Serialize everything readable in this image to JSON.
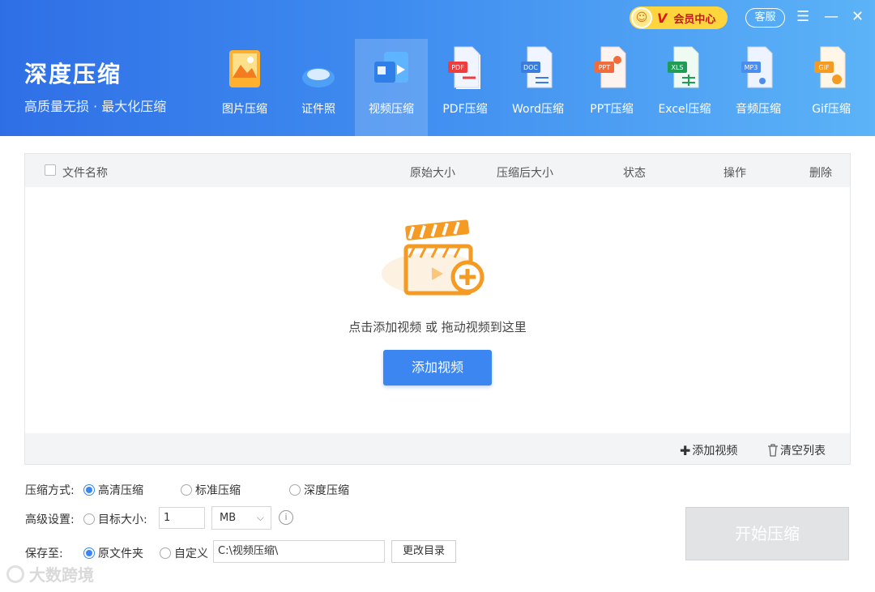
{
  "brand": {
    "title": "深度压缩",
    "subtitle": "高质量无损 · 最大化压缩"
  },
  "topbar": {
    "vip_label": "会员中心",
    "vip_letter": "V",
    "service_label": "客服",
    "menu_icon": "menu-icon",
    "minimize_icon": "minimize-icon",
    "close_icon": "close-icon"
  },
  "tabs": [
    {
      "label": "图片压缩",
      "icon": "image-file-icon"
    },
    {
      "label": "证件照",
      "icon": "id-photo-icon"
    },
    {
      "label": "视频压缩",
      "icon": "video-file-icon",
      "active": true
    },
    {
      "label": "PDF压缩",
      "icon": "pdf-file-icon",
      "badge": "PDF"
    },
    {
      "label": "Word压缩",
      "icon": "word-file-icon",
      "badge": "DOC"
    },
    {
      "label": "PPT压缩",
      "icon": "ppt-file-icon",
      "badge": "PPT"
    },
    {
      "label": "Excel压缩",
      "icon": "excel-file-icon",
      "badge": "XLS"
    },
    {
      "label": "音频压缩",
      "icon": "audio-file-icon",
      "badge": "MP3"
    },
    {
      "label": "Gif压缩",
      "icon": "gif-file-icon",
      "badge": "GIF"
    }
  ],
  "table": {
    "columns": [
      "文件名称",
      "原始大小",
      "压缩后大小",
      "状态",
      "操作",
      "删除"
    ]
  },
  "empty": {
    "hint": "点击添加视频 或 拖动视频到这里",
    "add_button": "添加视频"
  },
  "panel_footer": {
    "add_label": "添加视频",
    "clear_label": "清空列表"
  },
  "settings": {
    "mode_label": "压缩方式:",
    "modes": [
      {
        "label": "高清压缩",
        "selected": true
      },
      {
        "label": "标准压缩",
        "selected": false
      },
      {
        "label": "深度压缩",
        "selected": false
      }
    ],
    "advanced_label": "高级设置:",
    "target_size_label": "目标大小:",
    "target_size_value": "1",
    "unit_value": "MB",
    "save_label": "保存至:",
    "save_options": [
      {
        "label": "原文件夹",
        "selected": true
      },
      {
        "label": "自定义",
        "selected": false
      }
    ],
    "path_value": "C:\\视频压缩\\",
    "change_dir_label": "更改目录",
    "start_label": "开始压缩"
  },
  "watermark": "大数跨境",
  "colors": {
    "header_start": "#2f6fe6",
    "header_end": "#5cb3f7",
    "accent": "#3b86f0",
    "vip": "#ffd53d",
    "orange": "#f5a623"
  }
}
